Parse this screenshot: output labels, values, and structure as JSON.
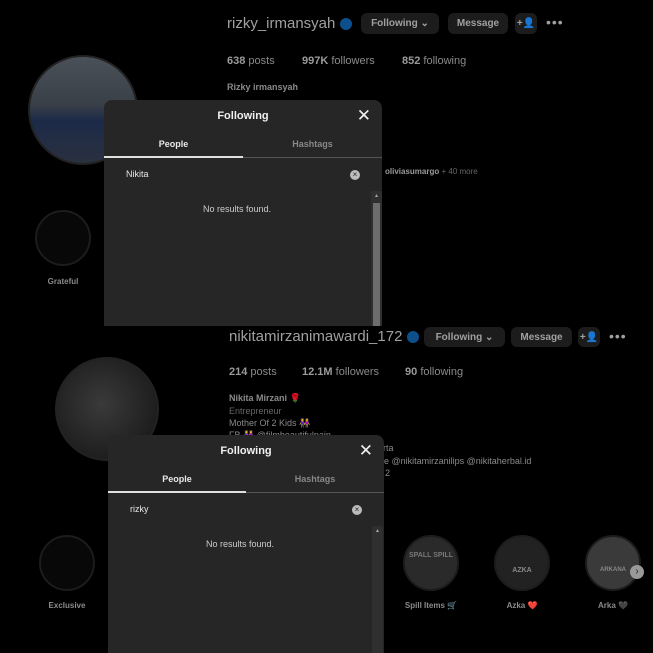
{
  "panels": [
    {
      "username": "rizky_irmansyah",
      "following_btn": "Following",
      "message_btn": "Message",
      "stats": {
        "posts": "638",
        "posts_label": "posts",
        "followers": "997K",
        "followers_label": "followers",
        "following": "852",
        "following_label": "following"
      },
      "name": "Rizky irmansyah",
      "followed_by": "oliviasumargo",
      "followed_more": "+ 40 more",
      "stories": [
        {
          "label": "Grateful"
        }
      ],
      "modal": {
        "title": "Following",
        "tabs": [
          "People",
          "Hashtags"
        ],
        "search_value": "Nikita",
        "empty": "No results found."
      }
    },
    {
      "username": "nikitamirzanimawardi_172",
      "following_btn": "Following",
      "message_btn": "Message",
      "stats": {
        "posts": "214",
        "posts_label": "posts",
        "followers": "12.1M",
        "followers_label": "followers",
        "following": "90",
        "following_label": "following"
      },
      "name": "Nikita Mirzani 🌹",
      "bio": [
        "Entrepreneur",
        "Mother Of 2 Kids 👭",
        "FB 👭 @filmbeautifulpain"
      ],
      "bio_partial": [
        "rta",
        "re @nikitamirzanilips @nikitaherbal.id",
        "2"
      ],
      "stories": [
        {
          "label": "Exclusive"
        },
        {
          "label": "Spill Items 🛒",
          "cover": "SPALL SPILL"
        },
        {
          "label": "Azka ❤️",
          "cover": "AZKA"
        },
        {
          "label": "Arka 🖤",
          "cover": "ARKANA"
        }
      ],
      "modal": {
        "title": "Following",
        "tabs": [
          "People",
          "Hashtags"
        ],
        "search_value": "rizky",
        "empty": "No results found."
      }
    }
  ],
  "colors": {
    "modal_bg": "#262626",
    "verified": "#0d4f8a"
  }
}
